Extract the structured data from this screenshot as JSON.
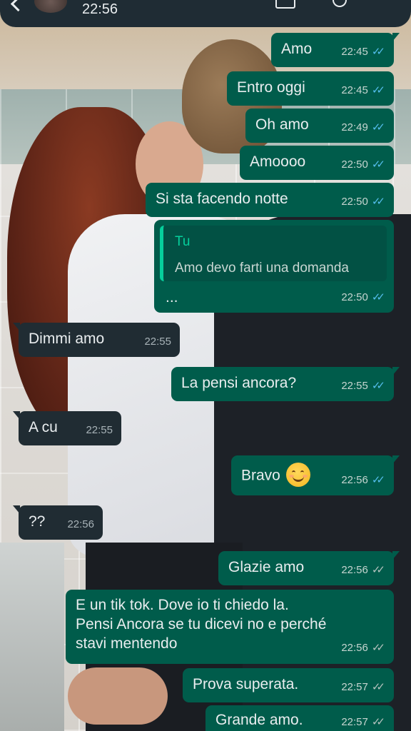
{
  "header": {
    "time": "22:56"
  },
  "messages": [
    {
      "text": "Amo",
      "time": "22:45",
      "status": "read"
    },
    {
      "text": "Entro oggi",
      "time": "22:45",
      "status": "read"
    },
    {
      "text": "Oh amo",
      "time": "22:49",
      "status": "read"
    },
    {
      "text": "Amoooo",
      "time": "22:50",
      "status": "read"
    },
    {
      "text": "Si sta facendo notte",
      "time": "22:50",
      "status": "read"
    },
    {
      "quote_author": "Tu",
      "quote_text": "Amo devo farti una domanda",
      "text": "...",
      "time": "22:50",
      "status": "read"
    },
    {
      "text": "Dimmi amo",
      "time": "22:55"
    },
    {
      "text": "La pensi ancora?",
      "time": "22:55",
      "status": "read"
    },
    {
      "text": "A cu",
      "time": "22:55"
    },
    {
      "text": "Bravo",
      "emoji": "smiling-face-emoji",
      "time": "22:56",
      "status": "read"
    },
    {
      "text": "??",
      "time": "22:56"
    },
    {
      "text": "Glazie amo",
      "time": "22:56",
      "status": "delivered"
    },
    {
      "lines": [
        "E un tik tok. Dove io ti chiedo la.",
        "Pensi Ancora se tu dicevi no e perché",
        "stavi mentendo"
      ],
      "time": "22:56",
      "status": "delivered"
    },
    {
      "text": "Prova superata.",
      "time": "22:57",
      "status": "delivered"
    },
    {
      "text": "Grande amo.",
      "time": "22:57",
      "status": "delivered"
    }
  ],
  "tick_glyph": "✓✓",
  "colors": {
    "outgoing": "#005c4b",
    "incoming": "#202c33",
    "read_ticks": "#53bdeb",
    "header": "#1f2c34"
  }
}
